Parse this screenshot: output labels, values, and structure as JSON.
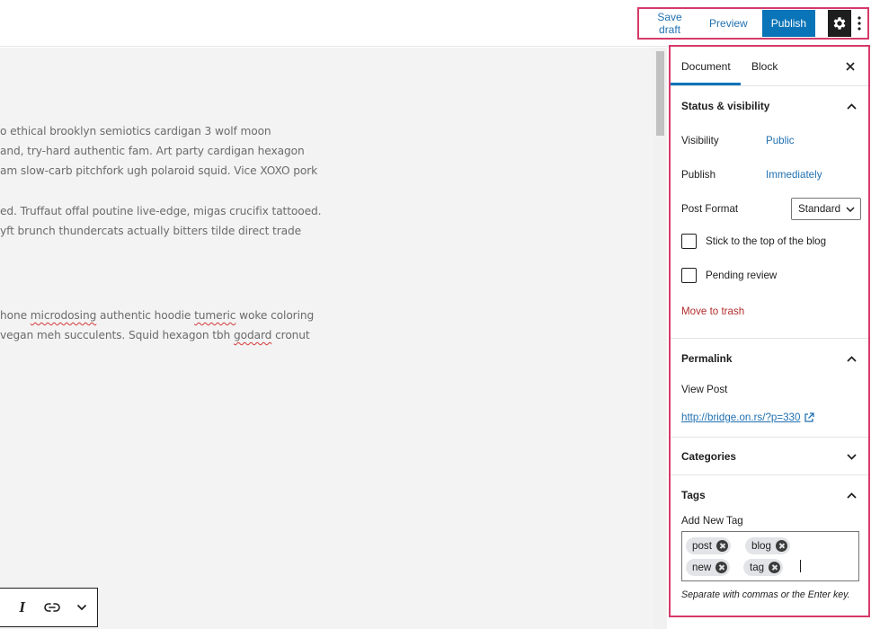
{
  "header": {
    "save_draft": "Save draft",
    "preview": "Preview",
    "publish": "Publish",
    "settings_icon": "gear-icon",
    "more_icon": "kebab-menu-icon"
  },
  "editor": {
    "paragraphs": [
      [
        "o ethical brooklyn semiotics cardigan 3 wolf moon",
        "and, try-hard authentic fam. Art party cardigan hexagon",
        "am slow-carb pitchfork ugh polaroid squid. Vice XOXO pork"
      ],
      [
        "ed. Truffaut offal poutine live-edge, migas crucifix tattooed.",
        "yft brunch thundercats actually bitters tilde direct trade"
      ]
    ],
    "p3_line1_a": "hone ",
    "p3_line1_w1": "microdosing",
    "p3_line1_b": " authentic hoodie ",
    "p3_line1_w2": "tumeric",
    "p3_line1_c": " woke coloring",
    "p3_line2_a": "vegan meh succulents. Squid hexagon tbh ",
    "p3_line2_w": "godard",
    "p3_line2_b": " cronut"
  },
  "block_toolbar": {
    "italic": "I",
    "link_icon": "link-icon",
    "more_icon": "chevron-down-icon"
  },
  "sidebar": {
    "tabs": {
      "document": "Document",
      "block": "Block"
    },
    "close_icon": "close-icon",
    "status": {
      "title": "Status & visibility",
      "visibility_label": "Visibility",
      "visibility_value": "Public",
      "publish_label": "Publish",
      "publish_value": "Immediately",
      "format_label": "Post Format",
      "format_value": "Standard",
      "sticky_label": "Stick to the top of the blog",
      "sticky_checked": false,
      "pending_label": "Pending review",
      "pending_checked": false,
      "trash": "Move to trash"
    },
    "permalink": {
      "title": "Permalink",
      "view_post": "View Post",
      "url": "http://bridge.on.rs/?p=330",
      "external_icon": "external-link-icon"
    },
    "categories": {
      "title": "Categories"
    },
    "tags": {
      "title": "Tags",
      "add_label": "Add New Tag",
      "items": [
        "post",
        "blog",
        "new",
        "tag"
      ],
      "help": "Separate with commas or the Enter key."
    }
  },
  "colors": {
    "accent": "#0a74b8",
    "link": "#2271b1",
    "danger": "#b32d2e",
    "highlight_border": "#d63a6a"
  }
}
